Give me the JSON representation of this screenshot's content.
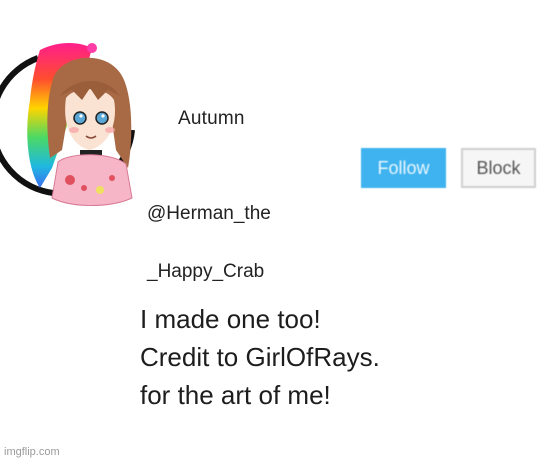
{
  "profile": {
    "display_name": "Autumn",
    "handle_line1": "@Herman_the",
    "handle_line2": "_Happy_Crab",
    "avatar_icon": "drawn-character-avatar-icon"
  },
  "actions": {
    "follow_label": "Follow",
    "block_label": "Block"
  },
  "post": {
    "lines": [
      "I made one too!",
      "Credit to GirlOfRays.",
      "for the art of me!"
    ]
  },
  "watermark": "imgflip.com",
  "colors": {
    "follow_bg": "#3fb3ef",
    "block_bg": "#f6f6f6",
    "text": "#1d1d1d"
  }
}
